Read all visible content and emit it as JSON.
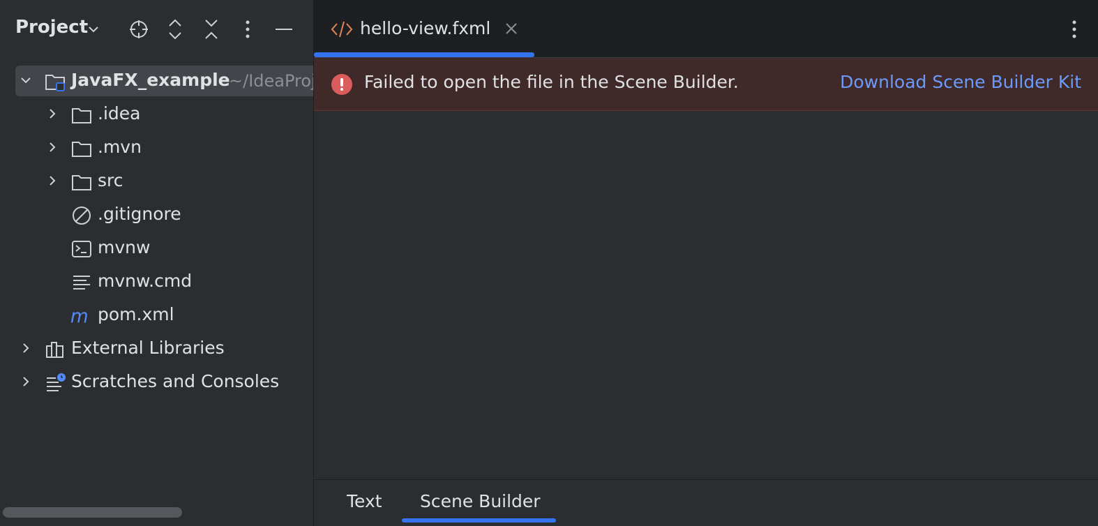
{
  "sidebar": {
    "title": "Project",
    "header_icons": [
      "locate-icon",
      "expand-all-icon",
      "collapse-all-icon",
      "more-vertical-icon",
      "minimize-icon"
    ],
    "root": {
      "label": "JavaFX_example",
      "path": "~/IdeaProjects/JavaFX_example"
    },
    "items": [
      {
        "label": ".idea",
        "icon": "folder-icon",
        "expandable": true
      },
      {
        "label": ".mvn",
        "icon": "folder-icon",
        "expandable": true
      },
      {
        "label": "src",
        "icon": "folder-icon",
        "expandable": true
      },
      {
        "label": ".gitignore",
        "icon": "ignore-file-icon",
        "expandable": false
      },
      {
        "label": "mvnw",
        "icon": "shell-script-icon",
        "expandable": false
      },
      {
        "label": "mvnw.cmd",
        "icon": "text-file-icon",
        "expandable": false
      },
      {
        "label": "pom.xml",
        "icon": "maven-icon",
        "expandable": false
      }
    ],
    "extras": [
      {
        "label": "External Libraries",
        "icon": "libraries-icon"
      },
      {
        "label": "Scratches and Consoles",
        "icon": "scratches-icon"
      }
    ]
  },
  "editor": {
    "tab": {
      "label": "hello-view.fxml",
      "icon": "xml-file-icon",
      "icon_color": "#e08855"
    },
    "banner": {
      "message": "Failed to open the file in the Scene Builder.",
      "link": "Download Scene Builder Kit",
      "error_color": "#db5c5c"
    },
    "bottom_tabs": [
      "Text",
      "Scene Builder"
    ],
    "active_bottom_tab": "Scene Builder"
  },
  "colors": {
    "accent": "#3574f0",
    "link": "#6b9bfa"
  }
}
